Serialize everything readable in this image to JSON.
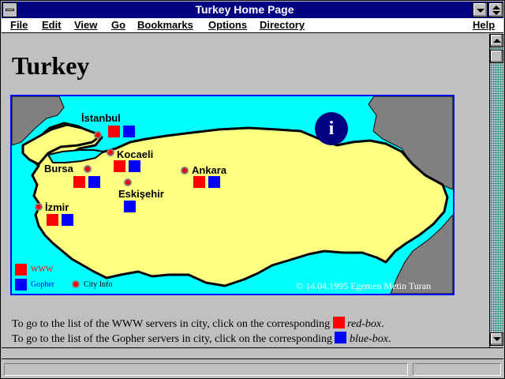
{
  "window": {
    "title": "Turkey Home Page"
  },
  "menu": {
    "items": [
      {
        "label": "File"
      },
      {
        "label": "Edit"
      },
      {
        "label": "View"
      },
      {
        "label": "Go"
      },
      {
        "label": "Bookmarks"
      },
      {
        "label": "Options"
      },
      {
        "label": "Directory"
      },
      {
        "label": "Help"
      }
    ]
  },
  "page": {
    "heading": "Turkey",
    "map": {
      "cities": [
        {
          "name": "İstanbul"
        },
        {
          "name": "Kocaeli"
        },
        {
          "name": "Bursa"
        },
        {
          "name": "Ankara"
        },
        {
          "name": "Eskişehir"
        },
        {
          "name": "İzmir"
        }
      ],
      "info_icon": "i",
      "legend": {
        "www": "WWW",
        "gopher": "Gopher",
        "city_info": "City Info"
      },
      "copyright": "© 14.04.1995 Egemen Metin Turan"
    },
    "instructions": {
      "line1_prefix": "To go to the list of the WWW servers in city, click on the corresponding",
      "line1_box": "red-box",
      "line2_prefix": "To go to the list of the Gopher servers in city, click on the corresponding",
      "line2_box": "blue-box",
      "end_punct": "."
    }
  },
  "colors": {
    "title_bar": "#000080",
    "sea": "#00ffff",
    "land": "#ffff80",
    "neighbor_land": "#808080",
    "www_box": "#ff0000",
    "gopher_box": "#0000ff",
    "frame": "#0000ff"
  }
}
